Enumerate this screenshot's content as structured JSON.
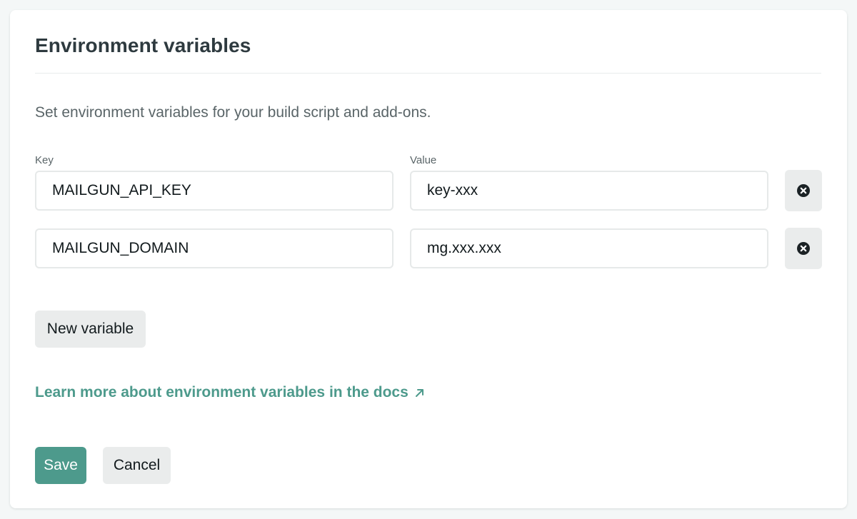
{
  "panel": {
    "title": "Environment variables",
    "description": "Set environment variables for your build script and add-ons."
  },
  "fields": {
    "key_label": "Key",
    "value_label": "Value"
  },
  "variables": [
    {
      "key": "MAILGUN_API_KEY",
      "value": "key-xxx"
    },
    {
      "key": "MAILGUN_DOMAIN",
      "value": "mg.xxx.xxx"
    }
  ],
  "actions": {
    "new_variable_label": "New variable",
    "docs_link_label": "Learn more about environment variables in the docs",
    "save_label": "Save",
    "cancel_label": "Cancel"
  },
  "icons": {
    "remove": "close-circle-icon",
    "external_link": "arrow-up-right-icon"
  },
  "colors": {
    "accent": "#4d9a8c",
    "title_text": "#2e3a3f",
    "muted_text": "#5a6568",
    "button_gray": "#eaecec"
  }
}
